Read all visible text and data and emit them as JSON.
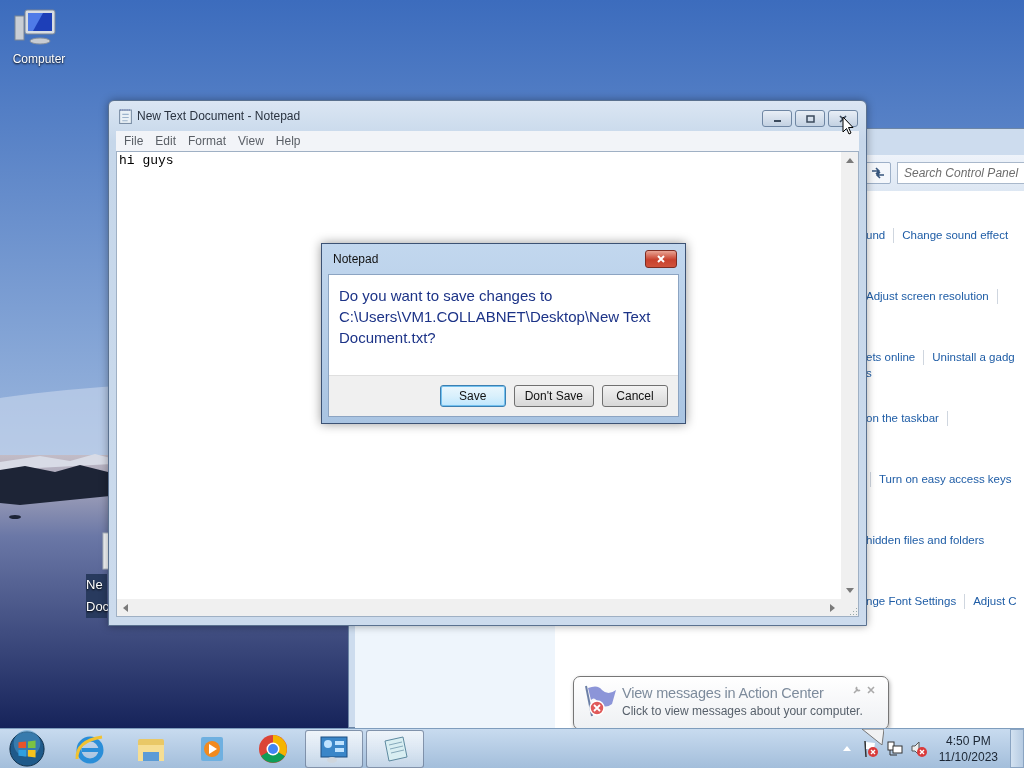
{
  "desktop_icons": [
    {
      "kind": "computer",
      "label": "Computer"
    },
    {
      "kind": "text_file",
      "label": "Ne Doc"
    }
  ],
  "control_panel": {
    "search": {
      "placeholder": "Search Control Panel"
    },
    "link_rows": [
      {
        "items": [
          {
            "kind": "link",
            "text": "und"
          },
          {
            "kind": "separator"
          },
          {
            "kind": "link",
            "text": "Change sound effect"
          }
        ]
      },
      {
        "items": [
          {
            "kind": "link",
            "text": "Adjust screen resolution"
          },
          {
            "kind": "separator"
          }
        ]
      },
      {
        "items": [
          {
            "kind": "link",
            "text": "ets online"
          },
          {
            "kind": "separator"
          },
          {
            "kind": "link",
            "text": "Uninstall a gadg"
          }
        ],
        "below": "s"
      },
      {
        "items": [
          {
            "kind": "link",
            "text": "on the taskbar"
          },
          {
            "kind": "separator"
          }
        ]
      },
      {
        "items": [
          {
            "kind": "separator"
          },
          {
            "kind": "link",
            "text": "Turn on easy access keys"
          }
        ]
      },
      {
        "items": [
          {
            "kind": "link",
            "text": "hidden files and folders"
          }
        ]
      },
      {
        "items": [
          {
            "kind": "link",
            "text": "nge Font Settings"
          },
          {
            "kind": "separator"
          },
          {
            "kind": "link",
            "text": "Adjust C"
          }
        ]
      }
    ]
  },
  "notepad": {
    "title": "New Text Document - Notepad",
    "menu": [
      "File",
      "Edit",
      "Format",
      "View",
      "Help"
    ],
    "text": "hi guys"
  },
  "dialog": {
    "title": "Notepad",
    "message": "Do you want to save changes to C:\\Users\\VM1.COLLABNET\\Desktop\\New Text Document.txt?",
    "buttons": [
      {
        "label": "Save",
        "default": true
      },
      {
        "label": "Don't Save",
        "default": false
      },
      {
        "label": "Cancel",
        "default": false
      }
    ]
  },
  "notification": {
    "title": "View messages in Action Center",
    "text": "Click to view messages about your computer."
  },
  "taskbar": {
    "items": [
      {
        "kind": "browser",
        "open": false
      },
      {
        "kind": "folder",
        "open": false
      },
      {
        "kind": "media",
        "open": false
      },
      {
        "kind": "wheel_browser",
        "open": false
      },
      {
        "kind": "control_panel",
        "open": true
      },
      {
        "kind": "notepad",
        "open": true
      }
    ],
    "clock": {
      "time": "4:50 PM",
      "date": "11/10/2023"
    }
  }
}
